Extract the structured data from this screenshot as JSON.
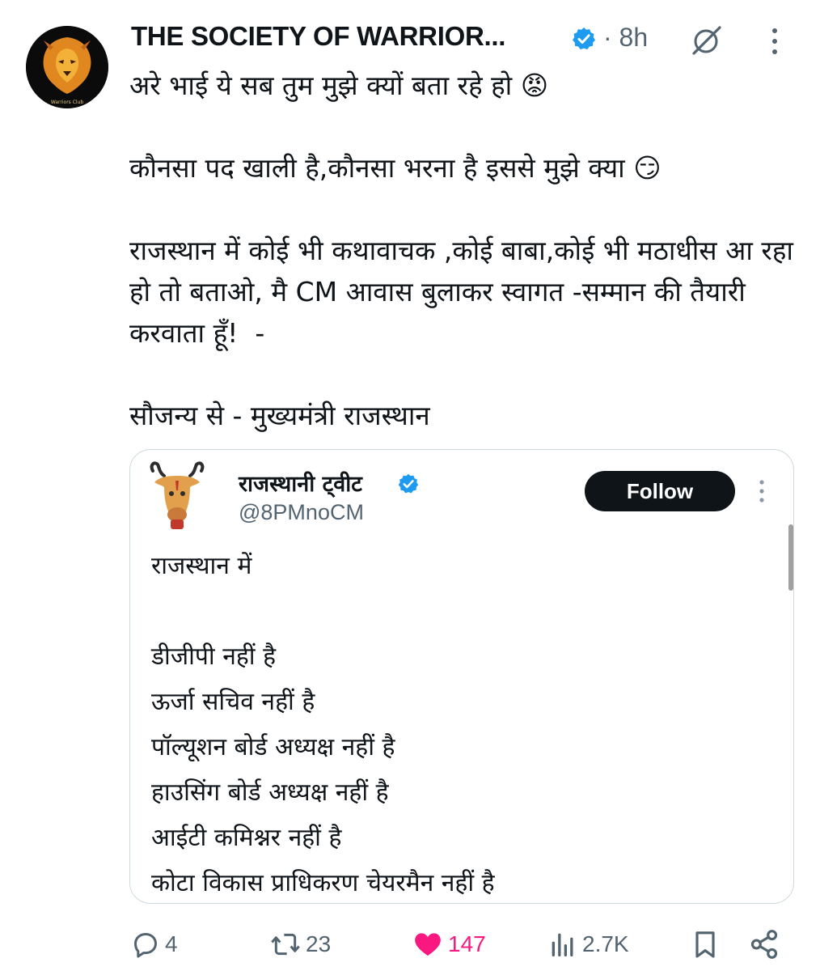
{
  "post": {
    "author_name": "THE SOCIETY OF WARRIOR...",
    "time": "· 8h",
    "avatar_text": "Warriors Club",
    "text": "अरे भाई ये सब तुम मुझे क्यों बता रहे हो 😡\n\nकौनसा पद खाली है,कौनसा भरना है इससे मुझे क्या 😏\n\nराजस्थान में कोई भी कथावाचक ,कोई बाबा,कोई भी मठाधीस आ रहा हो तो बताओ, मै CM आवास बुलाकर स्वागत -सम्मान की तैयारी करवाता हूँ!  -\n\nसौजन्य से - मुख्यमंत्री राजस्थान"
  },
  "quote": {
    "name": "राजस्थानी ट्वीट",
    "handle": "@8PMnoCM",
    "follow_label": "Follow",
    "text": "राजस्थान में\n\nडीजीपी नहीं है\nऊर्जा सचिव नहीं है\nपॉल्यूशन बोर्ड अध्यक्ष नहीं है\nहाउसिंग बोर्ड अध्यक्ष नहीं है\nआईटी कमिश्नर नहीं है\nकोटा विकास प्राधिकरण चेयरमैन नहीं है"
  },
  "actions": {
    "replies": "4",
    "reposts": "23",
    "likes": "147",
    "views": "2.7K"
  },
  "icons": {
    "verified": "verified-badge-icon",
    "grok": "grok-icon",
    "more": "more-vertical-icon",
    "reply": "reply-icon",
    "repost": "repost-icon",
    "like": "heart-icon",
    "views": "views-icon",
    "bookmark": "bookmark-icon",
    "share": "share-icon"
  },
  "colors": {
    "verified": "#1d9bf0",
    "like": "#f91880",
    "muted": "#536471",
    "text": "#0f1419"
  }
}
